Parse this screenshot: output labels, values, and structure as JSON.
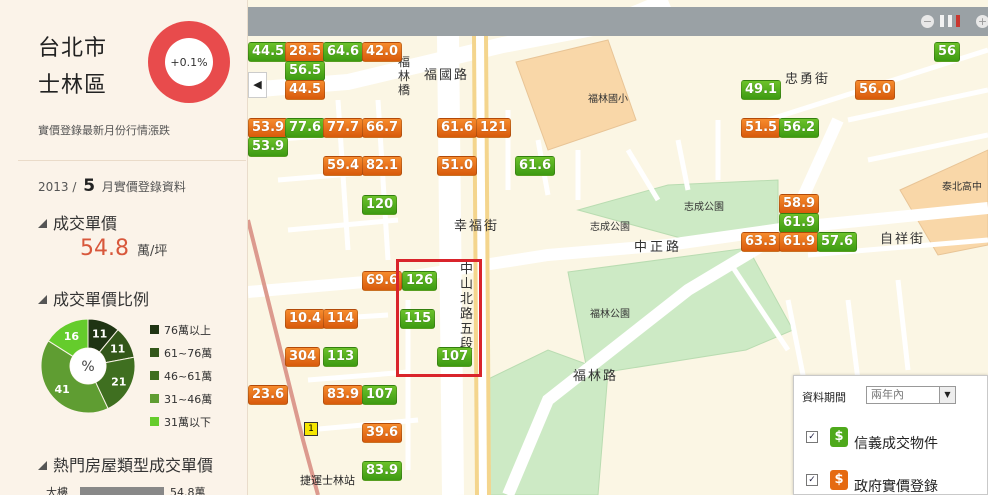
{
  "sidebar": {
    "city": "台北市",
    "district": "士林區",
    "change": "+0.1%",
    "change_note": "實價登錄最新月份行情漲跌",
    "period_year": "2013 /",
    "period_month": "5",
    "period_suffix": "月實價登錄資料",
    "unit_price_title": "成交單價",
    "unit_price_value": "54.8",
    "unit_price_unit": "萬/坪",
    "ratio_title": "成交單價比例",
    "pie_center": "%",
    "pie": [
      {
        "label": "76萬以上",
        "value": 11,
        "color": "#1f3413"
      },
      {
        "label": "61~76萬",
        "value": 11,
        "color": "#33571a"
      },
      {
        "label": "46~61萬",
        "value": 21,
        "color": "#3f6f20"
      },
      {
        "label": "31~46萬",
        "value": 41,
        "color": "#5f9d32"
      },
      {
        "label": "31萬以下",
        "value": 16,
        "color": "#65cc2c"
      }
    ],
    "popular_title": "熱門房屋類型成交單價",
    "popular_row_label": "大樓",
    "popular_row_value": "54.8萬"
  },
  "map": {
    "labels": {
      "fulin_elementary": "福林國小",
      "zhicheng_park": "志成公園",
      "zhicheng_park_small": "志成公園",
      "fulin_park": "福林公園",
      "taipei_high": "泰北高中",
      "mrt_station": "捷運士林站",
      "zhongzheng_rd": "中正路",
      "zhongshan_n_rd": "中山北路五段",
      "fuguo_rd": "福國路",
      "xingfu_st": "幸福街",
      "zhongyong_st": "忠勇街",
      "fulin_rd": "福林路",
      "zixiang_st": "自祥街",
      "fulin_bridge": "福林橋"
    },
    "markers": [
      {
        "text": "44.5",
        "color": "green"
      },
      {
        "text": "28.5",
        "color": "orange"
      },
      {
        "text": "64.6",
        "color": "green"
      },
      {
        "text": "42.0",
        "color": "orange"
      },
      {
        "text": "56.5",
        "color": "green"
      },
      {
        "text": "44.5",
        "color": "orange"
      },
      {
        "text": "53.9",
        "color": "orange"
      },
      {
        "text": "77.6",
        "color": "green"
      },
      {
        "text": "77.7",
        "color": "orange"
      },
      {
        "text": "66.7",
        "color": "orange"
      },
      {
        "text": "53.9",
        "color": "green"
      },
      {
        "text": "61.6",
        "color": "orange"
      },
      {
        "text": "121",
        "color": "orange"
      },
      {
        "text": "61.6",
        "color": "green"
      },
      {
        "text": "59.4",
        "color": "orange"
      },
      {
        "text": "82.1",
        "color": "orange"
      },
      {
        "text": "51.0",
        "color": "orange"
      },
      {
        "text": "120",
        "color": "green"
      },
      {
        "text": "69.6",
        "color": "orange"
      },
      {
        "text": "126",
        "color": "green"
      },
      {
        "text": "10.4",
        "color": "orange"
      },
      {
        "text": "114",
        "color": "orange"
      },
      {
        "text": "115",
        "color": "green"
      },
      {
        "text": "304",
        "color": "orange"
      },
      {
        "text": "113",
        "color": "green"
      },
      {
        "text": "107",
        "color": "green"
      },
      {
        "text": "23.6",
        "color": "orange"
      },
      {
        "text": "83.9",
        "color": "orange"
      },
      {
        "text": "107",
        "color": "green"
      },
      {
        "text": "39.6",
        "color": "orange"
      },
      {
        "text": "83.9",
        "color": "green"
      },
      {
        "text": "56",
        "color": "green"
      },
      {
        "text": "56.0",
        "color": "orange"
      },
      {
        "text": "49.1",
        "color": "green"
      },
      {
        "text": "51.5",
        "color": "orange"
      },
      {
        "text": "56.2",
        "color": "green"
      },
      {
        "text": "58.9",
        "color": "orange"
      },
      {
        "text": "61.9",
        "color": "green"
      },
      {
        "text": "63.3",
        "color": "orange"
      },
      {
        "text": "61.9",
        "color": "orange"
      },
      {
        "text": "57.6",
        "color": "green"
      }
    ]
  },
  "panel": {
    "period_label": "資料期間",
    "period_value": "兩年內",
    "opt1": "信義成交物件",
    "opt2": "政府實價登錄"
  },
  "colors": {
    "green": "#4ea91b",
    "orange": "#e56a12",
    "ring": "#e84b4c",
    "highlight": "#d9242b"
  }
}
